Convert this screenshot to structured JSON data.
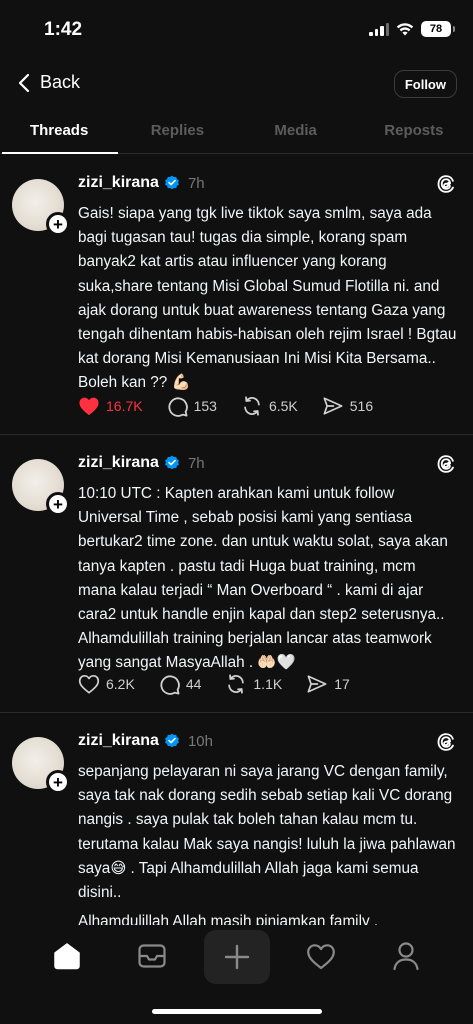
{
  "status_bar": {
    "time": "1:42",
    "battery": "78"
  },
  "nav": {
    "back_label": "Back",
    "follow_label": "Follow"
  },
  "tabs": [
    {
      "label": "Threads",
      "active": true
    },
    {
      "label": "Replies",
      "active": false
    },
    {
      "label": "Media",
      "active": false
    },
    {
      "label": "Reposts",
      "active": false
    }
  ],
  "posts": [
    {
      "username": "zizi_kirana",
      "time": "7h",
      "text": "Gais! siapa yang tgk live tiktok saya smlm, saya ada bagi tugasan tau! tugas dia simple, korang spam banyak2 kat artis atau influencer yang korang suka,share tentang Misi Global Sumud Flotilla ni. and ajak dorang untuk buat awareness tentang Gaza yang tengah dihentam habis-habisan oleh rejim Israel ! Bgtau kat dorang Misi Kemanusiaan Ini Misi Kita Bersama.. Boleh kan ?? 💪🏻",
      "likes": "16.7K",
      "liked": true,
      "comments": "153",
      "reposts": "6.5K",
      "shares": "516"
    },
    {
      "username": "zizi_kirana",
      "time": "7h",
      "text": "10:10 UTC : Kapten arahkan kami untuk follow Universal Time , sebab posisi kami yang sentiasa bertukar2 time zone. dan untuk waktu solat, saya akan tanya kapten . pastu tadi Huga buat training, mcm mana kalau terjadi “ Man Overboard “ . kami di ajar cara2 untuk handle enjin kapal dan step2 seterusnya.. Alhamdulillah training berjalan lancar atas teamwork yang sangat MasyaAllah . 🤲🏻🤍",
      "likes": "6.2K",
      "liked": false,
      "comments": "44",
      "reposts": "1.1K",
      "shares": "17"
    },
    {
      "username": "zizi_kirana",
      "time": "10h",
      "paragraphs": [
        "sepanjang pelayaran ni saya jarang VC dengan family, saya tak nak dorang sedih sebab setiap kali VC dorang nangis . saya pulak tak boleh tahan kalau mcm tu. terutama kalau Mak saya nangis! luluh la jiwa pahlawan saya😅 . Tapi Alhamdulillah Allah jaga kami semua disini..",
        "Alhamdulillah Allah masih pinjamkan family ."
      ]
    }
  ],
  "colors": {
    "background": "#101010",
    "like_red": "#ff3040",
    "verified_blue": "#0095f6",
    "muted": "#777777"
  },
  "icons": [
    "chevron-left-icon",
    "verified-icon",
    "threads-logo-icon",
    "heart-icon",
    "comment-icon",
    "repost-icon",
    "share-icon",
    "home-icon",
    "inbox-icon",
    "plus-icon",
    "activity-heart-icon",
    "profile-icon"
  ]
}
